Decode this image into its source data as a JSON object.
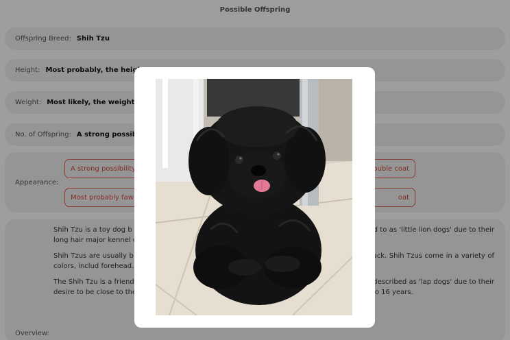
{
  "header": {
    "title": "Possible Offspring"
  },
  "fields": {
    "breed": {
      "label": "Offspring Breed:",
      "value": "Shih Tzu"
    },
    "height": {
      "label": "Height:",
      "value": "Most probably, the height"
    },
    "weight": {
      "label": "Weight:",
      "value": "Most likely, the weight is"
    },
    "offspring_count": {
      "label": "No. of Offspring:",
      "value": "A strong possibi"
    },
    "appearance": {
      "label": "Appearance:",
      "chips": [
        {
          "start": "A strong possibility",
          "end": "ouble coat"
        },
        {
          "start": "Most probably faw",
          "end": "oat"
        }
      ]
    },
    "overview": {
      "label": "Overview:",
      "paragraphs": [
        "Shih Tzu is a toy dog b                                                                   is known for their long, silky, and flowing hair. Shih Tzus                                                                   often referred to as 'little lion dogs' due to their long hair                                                                   major kennel clubs, including the American Kennel Club (",
        "Shih Tzus are usually b                                                                   hey have a round head with large, expressive eyes that ar                                                                   ver the back. Shih Tzus come in a variety of colors, includ                                                                   forehead.",
        "The Shih Tzu is a friendl                                                                   . They are also relatively easy to train, although they ca                                                                   d are often described as 'lap dogs' due to their desire to be close to their owners. Shih Tzus are generally healthy and have a lifespan of 10 to 16 years."
      ]
    }
  },
  "modal": {
    "image": "black-puppy-photo"
  },
  "colors": {
    "chip_border": "#e2604f",
    "row_bg": "#f1f1f1",
    "overlay": "rgba(0,0,0,0.38)"
  }
}
